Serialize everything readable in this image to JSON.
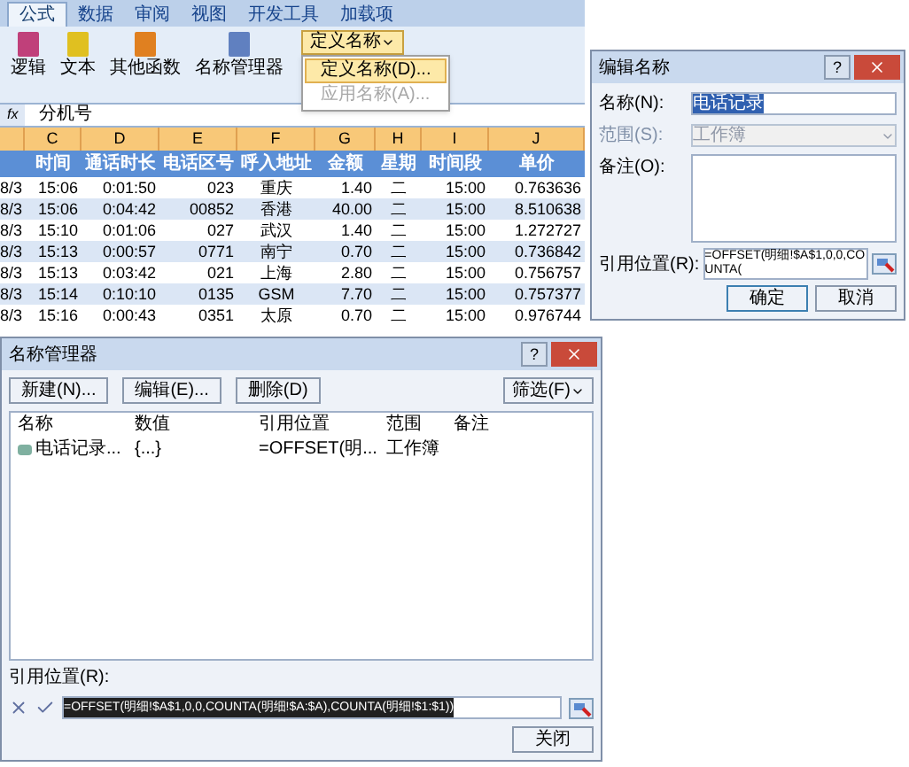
{
  "ribbon": {
    "tabs": [
      {
        "label": "公式",
        "selected": true
      },
      {
        "label": "数据",
        "selected": false
      },
      {
        "label": "审阅",
        "selected": false
      },
      {
        "label": "视图",
        "selected": false
      },
      {
        "label": "开发工具",
        "selected": false
      },
      {
        "label": "加载项",
        "selected": false
      }
    ],
    "buttons": [
      {
        "label": "逻辑",
        "color": "#c0407a"
      },
      {
        "label": "文本",
        "color": "#e0c020"
      },
      {
        "label": "其他函数",
        "color": "#e08020"
      },
      {
        "label": "名称管理器",
        "color": "#6080c0"
      }
    ],
    "define_name": {
      "label": "定义名称",
      "items": [
        {
          "label": "定义名称(D)...",
          "selected": true,
          "disabled": false
        },
        {
          "label": "应用名称(A)...",
          "selected": false,
          "disabled": true
        }
      ]
    }
  },
  "formula_bar": {
    "fx": "fx",
    "value": "分机号"
  },
  "sheet": {
    "columns": [
      "C",
      "D",
      "E",
      "F",
      "G",
      "H",
      "I",
      "J"
    ],
    "header": [
      "时间",
      "通话时长",
      "电话区号",
      "呼入地址",
      "金额",
      "星期",
      "时间段",
      "单价"
    ],
    "cut_column": [
      "8/3",
      "8/3",
      "8/3",
      "8/3",
      "8/3",
      "8/3",
      "8/3"
    ],
    "rows": [
      [
        "15:06",
        "0:01:50",
        "023",
        "重庆",
        "1.40",
        "二",
        "15:00",
        "0.763636"
      ],
      [
        "15:06",
        "0:04:42",
        "00852",
        "香港",
        "40.00",
        "二",
        "15:00",
        "8.510638"
      ],
      [
        "15:10",
        "0:01:06",
        "027",
        "武汉",
        "1.40",
        "二",
        "15:00",
        "1.272727"
      ],
      [
        "15:13",
        "0:00:57",
        "0771",
        "南宁",
        "0.70",
        "二",
        "15:00",
        "0.736842"
      ],
      [
        "15:13",
        "0:03:42",
        "021",
        "上海",
        "2.80",
        "二",
        "15:00",
        "0.756757"
      ],
      [
        "15:14",
        "0:10:10",
        "0135",
        "GSM",
        "7.70",
        "二",
        "15:00",
        "0.757377"
      ],
      [
        "15:16",
        "0:00:43",
        "0351",
        "太原",
        "0.70",
        "二",
        "15:00",
        "0.976744"
      ]
    ]
  },
  "edit_name_dialog": {
    "title": "编辑名称",
    "help": "?",
    "name_label": "名称(N):",
    "name_value": "电话记录",
    "scope_label": "范围(S):",
    "scope_value": "工作簿",
    "scope_disabled": true,
    "comment_label": "备注(O):",
    "refers_label": "引用位置(R):",
    "refers_value": "=OFFSET(明细!$A$1,0,0,COUNTA(",
    "buttons": [
      {
        "label": "确定",
        "selected": true
      },
      {
        "label": "取消",
        "selected": false
      }
    ]
  },
  "name_manager": {
    "title": "名称管理器",
    "help": "?",
    "buttons": [
      "新建(N)...",
      "编辑(E)...",
      "删除(D)"
    ],
    "filter": "筛选(F)",
    "columns": [
      "名称",
      "数值",
      "引用位置",
      "范围",
      "备注"
    ],
    "rows": [
      {
        "cells": [
          "电话记录...",
          "{...}",
          "=OFFSET(明...",
          "工作簿"
        ]
      }
    ],
    "refers_label": "引用位置(R):",
    "refers_value": "=OFFSET(明细!$A$1,0,0,COUNTA(明细!$A:$A),COUNTA(明细!$1:$1))",
    "close": "关闭"
  }
}
